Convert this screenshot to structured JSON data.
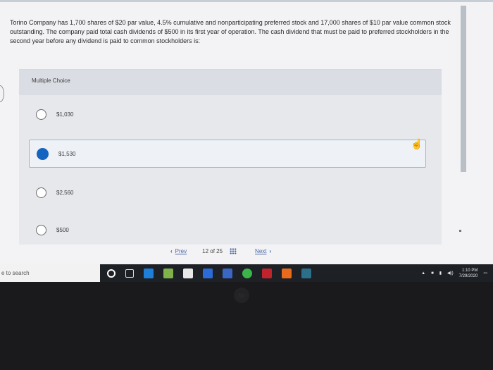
{
  "question": "Torino Company has 1,700 shares of $20 par value, 4.5% cumulative and nonparticipating preferred stock and 17,000 shares of $10 par value common stock outstanding. The company paid total cash dividends of $500 in its first year of operation. The cash dividend that must be paid to preferred stockholders in the second year before any dividend is paid to common stockholders is:",
  "multiple_choice_label": "Multiple Choice",
  "options": [
    "$1,030",
    "$1,530",
    "$2,560",
    "$500"
  ],
  "selected_index": 1,
  "nav": {
    "prev": "Prev",
    "page_indicator": "12 of 25",
    "next": "Next"
  },
  "taskbar": {
    "search_placeholder": "e to search",
    "time": "1:10 PM",
    "date": "7/29/2020"
  },
  "colors": {
    "selected_radio": "#1565c0",
    "nav_link": "#4a67a1",
    "taskbar": "#1d2025"
  }
}
